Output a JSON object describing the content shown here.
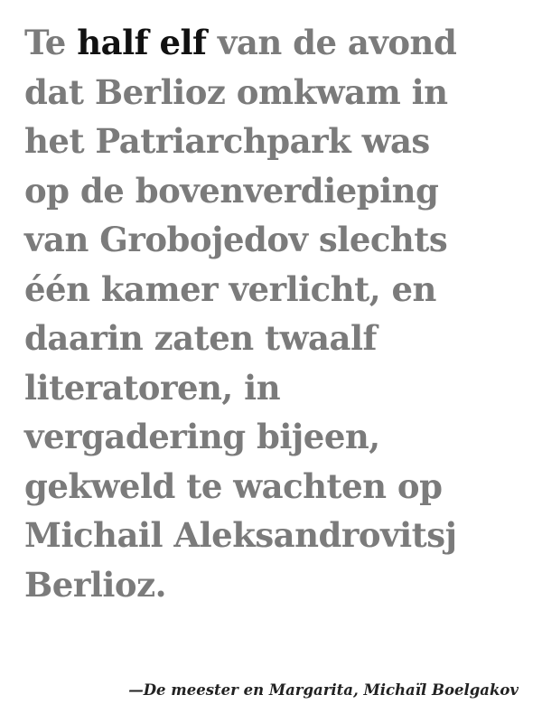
{
  "quote": {
    "line1_pre": "Te ",
    "line1_emph": "half elf",
    "line1_post": " van de avond",
    "line2": "dat Berlioz omkwam in",
    "line3": "het Patriarchpark was",
    "line4": "op de bovenverdieping",
    "line5": "van Grobojedov slechts",
    "line6": "één kamer verlicht, en",
    "line7": "daarin zaten twaalf",
    "line8": "literatoren, in",
    "line9": "vergadering bijeen,",
    "line10": "gekweld te wachten op",
    "line11": "Michail Aleksandrovitsj",
    "line12": "Berlioz."
  },
  "attribution": "—De meester en Margarita, Michaïl Boelgakov",
  "colors": {
    "text_muted": "#7b7b7b",
    "text_emphasis": "#111111",
    "background": "#ffffff"
  }
}
